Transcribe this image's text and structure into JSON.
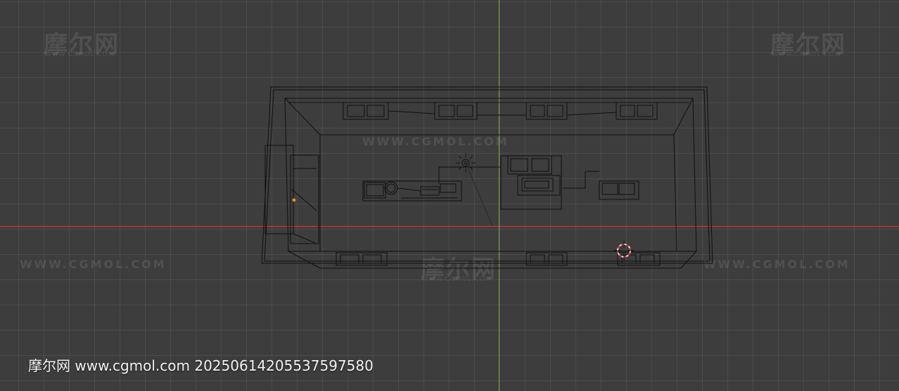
{
  "watermark": {
    "logo": "摩尔网",
    "sub": "WWW.CGMOL.COM",
    "url": "WWW.CGMOL.COM"
  },
  "footer": {
    "text": "摩尔网 www.cgmol.com 20250614205537597580"
  },
  "colors": {
    "background": "#3d3d3d",
    "x_axis": "#b84a4a",
    "y_axis": "#7aa83a",
    "wireframe": "#0f0f0f",
    "origin_dot": "#e08a2a"
  },
  "icons": [
    "light-icon",
    "3d-cursor-icon"
  ]
}
